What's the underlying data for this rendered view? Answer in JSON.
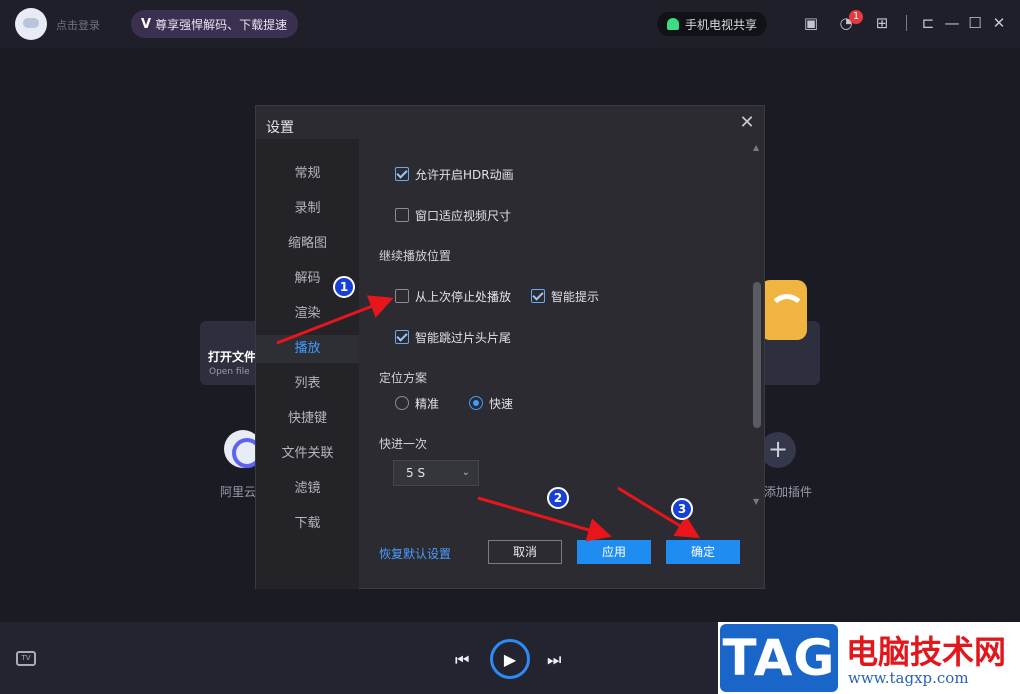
{
  "topbar": {
    "login_label": "点击登录",
    "promo_logo": "V",
    "promo_text": "尊享强悍解码、下载提速",
    "tv_share_label": "手机电视共享",
    "notification_count": "1",
    "icons": [
      "gift-icon",
      "bell-icon",
      "grid-icon",
      "pin-icon",
      "minimize-icon",
      "maximize-icon",
      "close-icon"
    ]
  },
  "background": {
    "open_file_title": "打开文件",
    "open_file_subtitle": "Open file",
    "aliyun_label": "阿里云盘",
    "add_plugin_label": "添加插件",
    "plus_glyph": "+"
  },
  "dialog": {
    "title": "设置",
    "sidebar": [
      {
        "label": "常规",
        "active": false
      },
      {
        "label": "录制",
        "active": false
      },
      {
        "label": "缩略图",
        "active": false
      },
      {
        "label": "解码",
        "active": false
      },
      {
        "label": "渲染",
        "active": false
      },
      {
        "label": "播放",
        "active": true
      },
      {
        "label": "列表",
        "active": false
      },
      {
        "label": "快捷键",
        "active": false
      },
      {
        "label": "文件关联",
        "active": false
      },
      {
        "label": "滤镜",
        "active": false
      },
      {
        "label": "下载",
        "active": false
      }
    ],
    "options": {
      "hdr_animation": {
        "label": "允许开启HDR动画",
        "checked": true
      },
      "fit_window": {
        "label": "窗口适应视频尺寸",
        "checked": false
      },
      "resume_section": "继续播放位置",
      "resume_last": {
        "label": "从上次停止处播放",
        "checked": false
      },
      "smart_hint": {
        "label": "智能提示",
        "checked": true
      },
      "skip_intro": {
        "label": "智能跳过片头片尾",
        "checked": true
      },
      "seek_section": "定位方案",
      "seek_precise": {
        "label": "精准",
        "selected": false
      },
      "seek_fast": {
        "label": "快速",
        "selected": true
      },
      "ff_section": "快进一次",
      "ff_value": "5 S"
    },
    "restore_label": "恢复默认设置",
    "cancel_label": "取消",
    "apply_label": "应用",
    "ok_label": "确定"
  },
  "annotations": {
    "marker1": "1",
    "marker2": "2",
    "marker3": "3",
    "arrow_color": "#e8161c"
  },
  "bottombar": {
    "tv_icon_label": "TV"
  },
  "watermark": {
    "tag": "TAG",
    "title": "电脑技术网",
    "url": "www.tagxp.com"
  },
  "colors": {
    "accent": "#1f8cf2",
    "active_text": "#3c9cff",
    "dialog_bg": "#2b2b31"
  }
}
